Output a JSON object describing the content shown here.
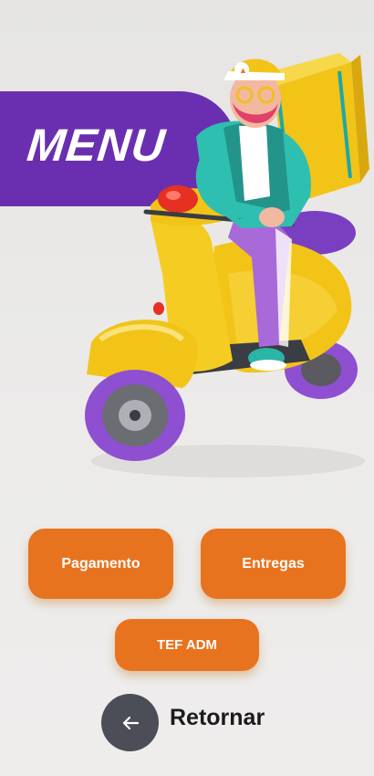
{
  "menu": {
    "title": "MENU"
  },
  "buttons": {
    "pagamento": "Pagamento",
    "entregas": "Entregas",
    "tef_adm": "TEF ADM"
  },
  "back": {
    "label": "Retornar",
    "icon": "arrow-left-icon"
  },
  "colors": {
    "accent": "#e8731f",
    "brand_purple": "#6a2fb0",
    "back_button": "#4b4d57",
    "scooter_yellow": "#f2c418",
    "shirt_teal": "#2fbfb0"
  }
}
